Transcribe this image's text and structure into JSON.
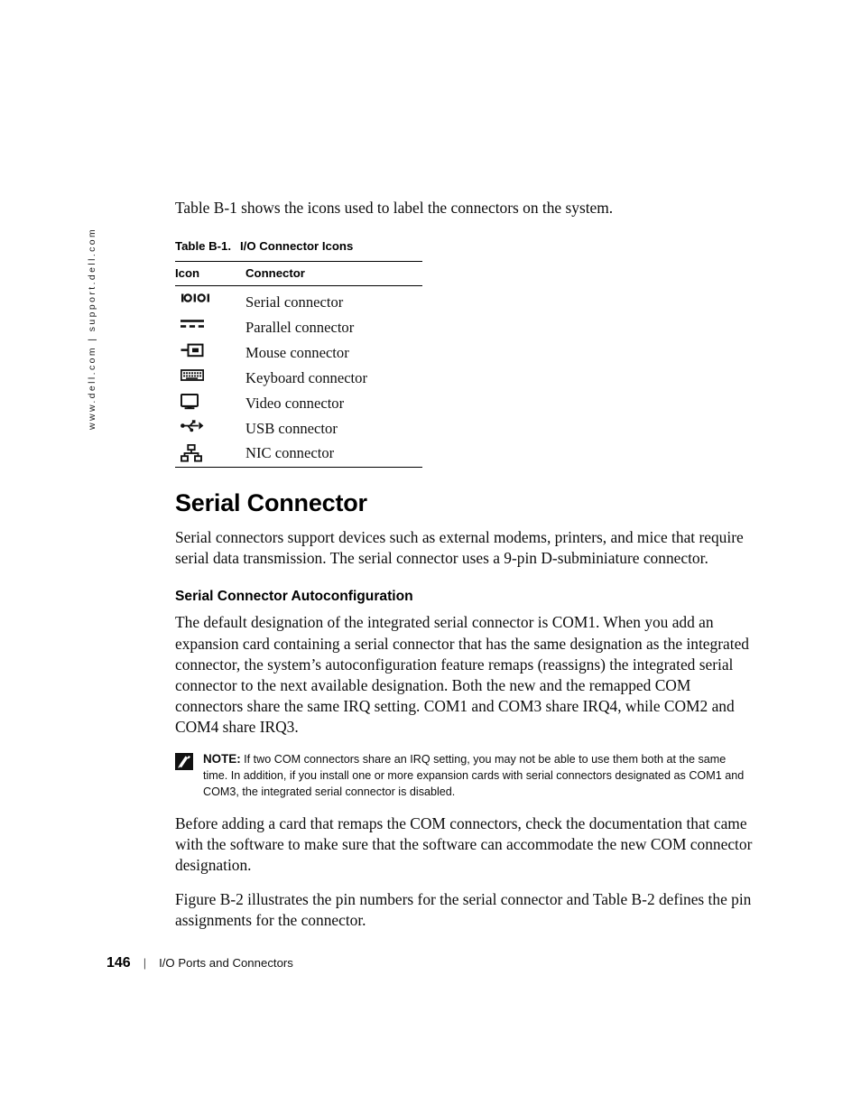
{
  "side_note": {
    "url_text": "www.dell.com | support.dell.com"
  },
  "intro": {
    "paragraph": "Table B-1 shows the icons used to label the connectors on the system."
  },
  "table": {
    "caption_number": "Table B-1.",
    "caption_title": "I/O Connector Icons",
    "headers": {
      "icon": "Icon",
      "connector": "Connector"
    },
    "rows": [
      {
        "icon_name": "serial-connector-icon",
        "connector": "Serial connector"
      },
      {
        "icon_name": "parallel-connector-icon",
        "connector": "Parallel connector"
      },
      {
        "icon_name": "mouse-connector-icon",
        "connector": "Mouse connector"
      },
      {
        "icon_name": "keyboard-connector-icon",
        "connector": "Keyboard connector"
      },
      {
        "icon_name": "video-connector-icon",
        "connector": "Video connector"
      },
      {
        "icon_name": "usb-connector-icon",
        "connector": "USB connector"
      },
      {
        "icon_name": "nic-connector-icon",
        "connector": "NIC connector"
      }
    ]
  },
  "section": {
    "heading": "Serial Connector",
    "paragraph": "Serial connectors support devices such as external modems, printers, and mice that require serial data transmission. The serial connector uses a 9-pin D-subminiature connector."
  },
  "subsection": {
    "heading": "Serial Connector Autoconfiguration",
    "paragraph": "The default designation of the integrated serial connector is COM1. When you add an expansion card containing a serial connector that has the same designation as the integrated connector, the system’s autoconfiguration feature remaps (reassigns) the integrated serial connector to the next available designation. Both the new and the remapped COM connectors share the same IRQ setting. COM1 and COM3 share IRQ4, while COM2 and COM4 share IRQ3."
  },
  "note": {
    "icon_name": "note-pencil-icon",
    "label": "NOTE:",
    "text": "If two COM connectors share an IRQ setting, you may not be able to use them both at the same time. In addition, if you install one or more expansion cards with serial connectors designated as COM1 and COM3, the integrated serial connector is disabled."
  },
  "after_note": {
    "paragraph1": "Before adding a card that remaps the COM connectors, check the documentation that came with the software to make sure that the software can accommodate the new COM connector designation.",
    "paragraph2": "Figure B-2 illustrates the pin numbers for the serial connector and Table B-2 defines the pin assignments for the connector."
  },
  "footer": {
    "page_number": "146",
    "separator": "|",
    "title": "I/O Ports and Connectors"
  },
  "colors": {
    "text": "#0d0d0d",
    "rule": "#000000"
  }
}
